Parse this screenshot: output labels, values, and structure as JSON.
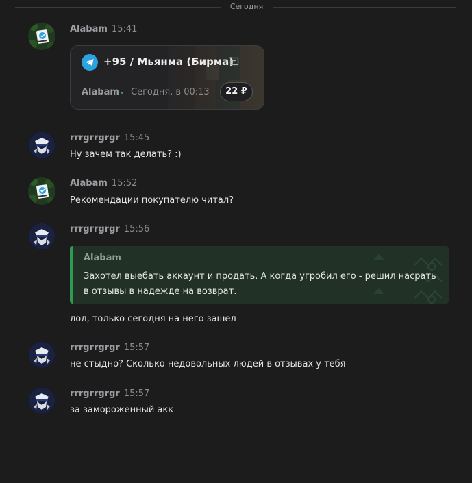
{
  "divider": {
    "label": "Сегодня"
  },
  "messages": [
    {
      "author": "Alabam",
      "time": "15:41",
      "avatar": "alabam-avatar",
      "card": {
        "title": "+95 / Мьянма (Бирма)",
        "seller": "Alabam",
        "date": "Сегодня, в 00:13",
        "price": "22 ₽",
        "icon": "telegram-icon",
        "cart_icon": "cart-icon"
      }
    },
    {
      "author": "rrrgrrgrgr",
      "time": "15:45",
      "avatar": "rrrgrrgrgr-avatar",
      "text": "Ну зачем так делать? :)"
    },
    {
      "author": "Alabam",
      "time": "15:52",
      "avatar": "alabam-avatar",
      "text": "Рекомендации покупателю читал?"
    },
    {
      "author": "rrrgrrgrgr",
      "time": "15:56",
      "avatar": "rrrgrrgrgr-avatar",
      "quote": {
        "author": "Alabam",
        "text": "Захотел выебать аккаунт и продать. А когда угробил его - решил насрать в отзывы в надежде на возврат."
      },
      "text": "лол, только сегодня на него зашел"
    },
    {
      "author": "rrrgrrgrgr",
      "time": "15:57",
      "avatar": "rrrgrrgrgr-avatar",
      "text": "не стыдно? Сколько недовольных людей в отзывах у тебя"
    },
    {
      "author": "rrrgrrgrgr",
      "time": "15:57",
      "avatar": "rrrgrrgrgr-avatar",
      "text": "за замороженный акк"
    }
  ],
  "colors": {
    "background": "#1c1c1d",
    "quote_bar": "#2f9a52",
    "telegram": "#2aa3df"
  }
}
